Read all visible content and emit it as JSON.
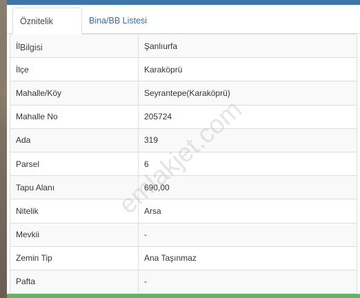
{
  "tabs": [
    {
      "label": "Öznitelik Bilgisi",
      "active": true
    },
    {
      "label": "Bina/BB Listesi",
      "active": false
    }
  ],
  "rows": [
    {
      "label": "İl",
      "value": "Şanlıurfa"
    },
    {
      "label": "İlçe",
      "value": "Karaköprü"
    },
    {
      "label": "Mahalle/Köy",
      "value": "Seyrantepe(Karaköprü)"
    },
    {
      "label": "Mahalle No",
      "value": "205724"
    },
    {
      "label": "Ada",
      "value": "319"
    },
    {
      "label": "Parsel",
      "value": "6"
    },
    {
      "label": "Tapu Alanı",
      "value": "690,00"
    },
    {
      "label": "Nitelik",
      "value": "Arsa"
    },
    {
      "label": "Mevkii",
      "value": "-"
    },
    {
      "label": "Zemin Tip",
      "value": "Ana Taşınmaz"
    },
    {
      "label": "Pafta",
      "value": "-"
    }
  ],
  "watermark": "emlakjet.com",
  "colors": {
    "top_bar": "#3f74a8",
    "bottom_bar": "#5cb85c",
    "tab_link": "#2a6fb4"
  }
}
